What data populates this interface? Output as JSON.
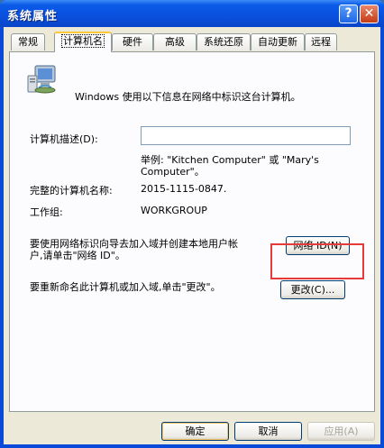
{
  "window": {
    "title": "系统属性",
    "help_glyph": "?",
    "close_glyph": "✕"
  },
  "tabs": [
    {
      "label": "常规"
    },
    {
      "label": "计算机名"
    },
    {
      "label": "硬件"
    },
    {
      "label": "高级"
    },
    {
      "label": "系统还原"
    },
    {
      "label": "自动更新"
    },
    {
      "label": "远程"
    }
  ],
  "active_tab_index": 1,
  "computer_name": {
    "intro": "Windows 使用以下信息在网络中标识这台计算机。",
    "description_label": "计算机描述(D):",
    "description_value": "",
    "example_line1": "举例: \"Kitchen Computer\" 或 \"Mary's",
    "example_line2": "Computer\"。",
    "full_name_label": "完整的计算机名称:",
    "full_name_value": "2015-1115-0847.",
    "workgroup_label": "工作组:",
    "workgroup_value": "WORKGROUP",
    "network_id_text_line1": "要使用网络标识向导去加入域并创建本地用户帐",
    "network_id_text_line2": "户,请单击\"网络 ID\"。",
    "network_id_button": "网络 ID(N)",
    "rename_text": "要重新命名此计算机或加入域,单击\"更改\"。",
    "change_button": "更改(C)..."
  },
  "footer": {
    "ok_button": "确定",
    "cancel_button": "取消",
    "apply_button": "应用(A)"
  },
  "colors": {
    "title_bar": "#0a4fde",
    "dialog_bg": "#ece9d8",
    "highlight": "#e53a3a",
    "active_tab_accent": "#ffc83c"
  }
}
